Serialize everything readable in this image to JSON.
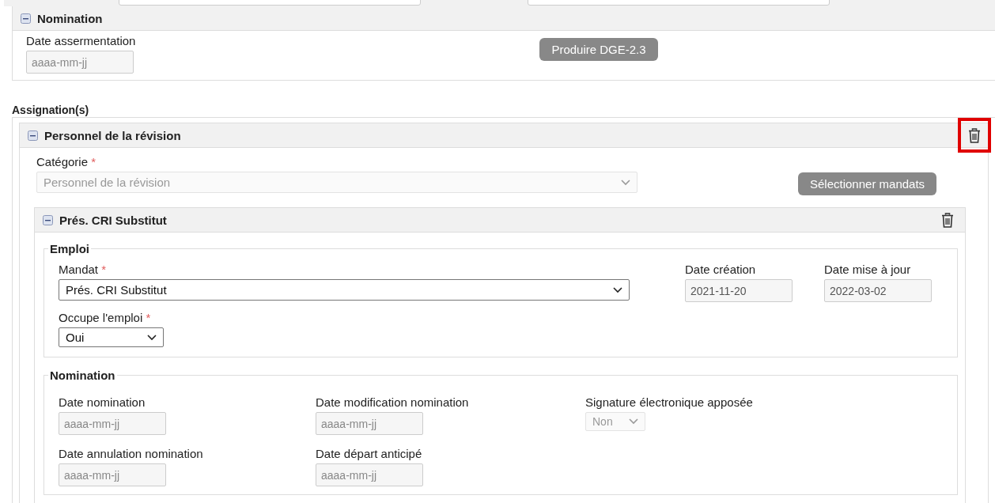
{
  "nomination_panel": {
    "title": "Nomination",
    "expanded": true,
    "field": {
      "label": "Date assermentation",
      "placeholder": "aaaa-mm-jj",
      "disabled": true
    },
    "button": "Produire DGE-2.3"
  },
  "assignations": {
    "title": "Assignation(s)",
    "items": [
      {
        "title": "Personnel de la révision",
        "expanded": true,
        "delete_highlighted": true,
        "category": {
          "label": "Catégorie",
          "required_mark": "*",
          "value": "Personnel de la révision",
          "disabled": true
        },
        "select_button": "Sélectionner mandats",
        "mandates": [
          {
            "title": "Prés. CRI Substitut",
            "expanded": true,
            "delete_highlighted": false,
            "emploi": {
              "legend": "Emploi",
              "mandat": {
                "label": "Mandat",
                "required_mark": "*",
                "value": "Prés. CRI Substitut",
                "disabled": false
              },
              "occupe": {
                "label": "Occupe l'emploi",
                "required_mark": "*",
                "value": "Oui",
                "disabled": false
              },
              "date_creation": {
                "label": "Date création",
                "value": "2021-11-20",
                "disabled": true
              },
              "date_mise_a_jour": {
                "label": "Date mise à jour",
                "value": "2022-03-02",
                "disabled": true
              }
            },
            "nomination": {
              "legend": "Nomination",
              "fields": [
                {
                  "kind": "date",
                  "label": "Date nomination",
                  "placeholder": "aaaa-mm-jj",
                  "disabled": true
                },
                {
                  "kind": "date",
                  "label": "Date modification nomination",
                  "placeholder": "aaaa-mm-jj",
                  "disabled": true
                },
                {
                  "kind": "select",
                  "label": "Signature électronique apposée",
                  "value": "Non",
                  "disabled": true
                },
                {
                  "kind": "date",
                  "label": "Date annulation nomination",
                  "placeholder": "aaaa-mm-jj",
                  "disabled": true
                },
                {
                  "kind": "date",
                  "label": "Date départ anticipé",
                  "placeholder": "aaaa-mm-jj",
                  "disabled": true
                }
              ]
            }
          }
        ]
      }
    ]
  }
}
